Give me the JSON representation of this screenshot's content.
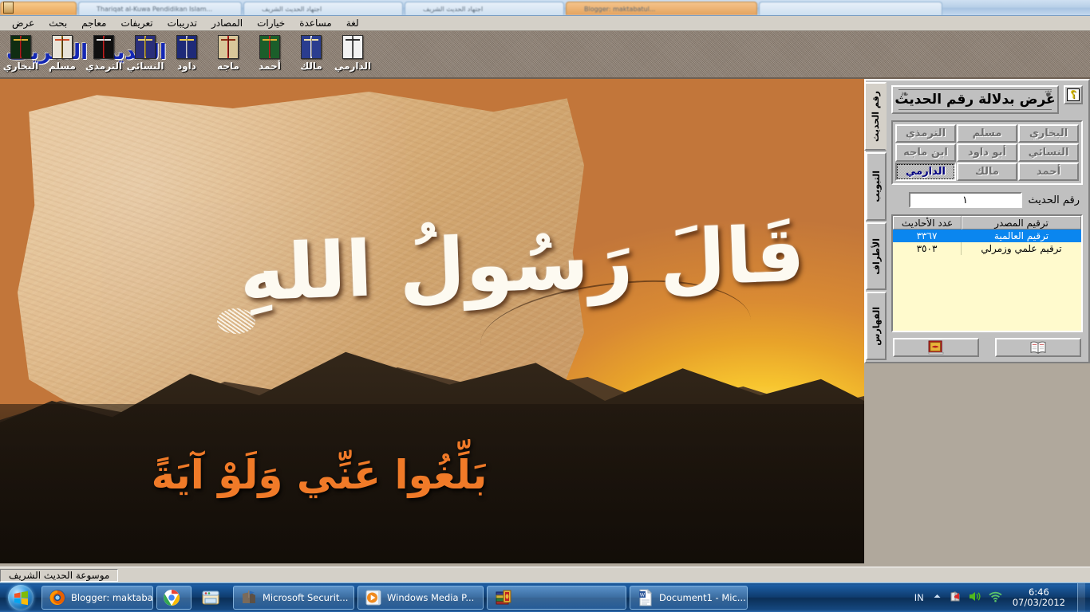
{
  "browser": {
    "tabs": [
      {
        "title": ""
      },
      {
        "title": "Thariqat al-Kuwa Pendidikan Islam..."
      },
      {
        "title": "اجتهاد الحديث الشريف"
      },
      {
        "title": "اجتهاد الحديث الشريف"
      },
      {
        "title": "Blogger: maktabatul..."
      },
      {
        "title": ""
      }
    ]
  },
  "app": {
    "title": "موسوعة الحديث الشريف",
    "logo": "الحديث الشريف",
    "statusbar": "موسوعة الحديث الشريف"
  },
  "menubar": {
    "items": [
      {
        "label": "عرض",
        "name": "menu-view"
      },
      {
        "label": "بحث",
        "name": "menu-search"
      },
      {
        "label": "معاجم",
        "name": "menu-dictionaries"
      },
      {
        "label": "تعريفات",
        "name": "menu-definitions"
      },
      {
        "label": "تدريبات",
        "name": "menu-exercises"
      },
      {
        "label": "المصادر",
        "name": "menu-sources"
      },
      {
        "label": "خيارات",
        "name": "menu-options"
      },
      {
        "label": "مساعدة",
        "name": "menu-help"
      },
      {
        "label": "لغة",
        "name": "menu-language"
      }
    ]
  },
  "toolbar": {
    "buttons": [
      {
        "label": "البخاري",
        "name": "toolbar-bukhari",
        "cover": "#0f2d12",
        "spine": "#b21d1d",
        "accent": "#e0b032"
      },
      {
        "label": "مسلم",
        "name": "toolbar-muslim",
        "cover": "#e8e4d8",
        "spine": "#8a6a1a",
        "accent": "#d04a24"
      },
      {
        "label": "الترمذي",
        "name": "toolbar-tirmidhi",
        "cover": "#101010",
        "spine": "#c01f1f",
        "accent": "#e6e6e6"
      },
      {
        "label": "النسائي",
        "name": "toolbar-nasai",
        "cover": "#2a2f7a",
        "spine": "#d4b43a",
        "accent": "#e8d06a"
      },
      {
        "label": "داود",
        "name": "toolbar-dawud",
        "cover": "#1e2a78",
        "spine": "#c9c9dd",
        "accent": "#f0d24a"
      },
      {
        "label": "ماجه",
        "name": "toolbar-majah",
        "cover": "#d9c79a",
        "spine": "#b81f1f",
        "accent": "#8a2b12"
      },
      {
        "label": "أحمد",
        "name": "toolbar-ahmad",
        "cover": "#1b5e2a",
        "spine": "#c32222",
        "accent": "#e0b032"
      },
      {
        "label": "مالك",
        "name": "toolbar-malik",
        "cover": "#2a3d8f",
        "spine": "#e8e8f0",
        "accent": "#f2e2a8"
      },
      {
        "label": "الدارمي",
        "name": "toolbar-darimi",
        "cover": "#f2f2f2",
        "spine": "#5a5a5a",
        "accent": "#303030"
      }
    ]
  },
  "wallpaper": {
    "calligraphy_main": "قَالَ رَسُولُ اللهِ",
    "calligraphy_sub": "بَلِّغُوا عَنِّي وَلَوْ آيَةً"
  },
  "panel": {
    "title": "عرض بدلالة رقم الحديث",
    "help_label": "؟",
    "vertical_tabs": [
      {
        "label": "رقم الحديث",
        "active": true,
        "name": "vtab-hadith-number"
      },
      {
        "label": "التبويب",
        "active": false,
        "name": "vtab-chapters"
      },
      {
        "label": "الأطراف",
        "active": false,
        "name": "vtab-atraf"
      },
      {
        "label": "الفهارس",
        "active": false,
        "name": "vtab-indexes"
      }
    ],
    "sources": [
      {
        "label": "البخاري",
        "selected": false,
        "name": "source-bukhari"
      },
      {
        "label": "مسلم",
        "selected": false,
        "name": "source-muslim"
      },
      {
        "label": "الترمذي",
        "selected": false,
        "name": "source-tirmidhi"
      },
      {
        "label": "النسائي",
        "selected": false,
        "name": "source-nasai"
      },
      {
        "label": "أبو داود",
        "selected": false,
        "name": "source-abu-dawud"
      },
      {
        "label": "ابن ماجه",
        "selected": false,
        "name": "source-ibn-majah"
      },
      {
        "label": "أحمد",
        "selected": false,
        "name": "source-ahmad"
      },
      {
        "label": "مالك",
        "selected": false,
        "name": "source-malik"
      },
      {
        "label": "الدارمي",
        "selected": true,
        "name": "source-darimi"
      }
    ],
    "number_field": {
      "label": "رقم الحديث",
      "value": "١",
      "placeholder": ""
    },
    "table": {
      "headers": {
        "source": "ترقيم المصدر",
        "count": "عدد الأحاديث"
      },
      "rows": [
        {
          "source": "ترقيم العالمية",
          "count": "٣٣٦٧",
          "selected": true
        },
        {
          "source": "ترقيم علمي وزمرلي",
          "count": "٣٥٠٣",
          "selected": false
        }
      ]
    },
    "actions": [
      {
        "name": "action-closed-book",
        "icon": "closed-book-icon"
      },
      {
        "name": "action-open-book",
        "icon": "open-book-icon"
      }
    ]
  },
  "taskbar": {
    "start": "start-orb",
    "tasks": [
      {
        "label": "Blogger: maktaba...",
        "icon": "firefox-icon",
        "name": "taskbar-firefox",
        "pinned": false
      },
      {
        "label": "",
        "icon": "chrome-icon",
        "name": "taskbar-chrome",
        "pinned": true
      },
      {
        "label": "",
        "icon": "explorer-icon",
        "name": "taskbar-explorer",
        "pinned": true
      },
      {
        "label": "Microsoft Securit...",
        "icon": "security-essentials-icon",
        "name": "taskbar-security-essentials",
        "pinned": false
      },
      {
        "label": "Windows Media P...",
        "icon": "media-player-icon",
        "name": "taskbar-media-player",
        "pinned": false
      },
      {
        "label": "",
        "icon": "hadith-books-icon",
        "name": "taskbar-hadith-app",
        "pinned": false
      },
      {
        "label": "Document1 - Mic...",
        "icon": "word-icon",
        "name": "taskbar-word",
        "pinned": false
      }
    ],
    "tray": {
      "language": "IN",
      "icons": [
        {
          "name": "show-hidden-icons-arrow"
        },
        {
          "name": "security-shield-icon"
        },
        {
          "name": "volume-icon"
        },
        {
          "name": "network-wifi-icon"
        }
      ],
      "time": "6:46",
      "date": "07/03/2012"
    }
  },
  "colors": {
    "accent_blue": "#0a86ef",
    "window_face": "#c0c0c0",
    "listbox_bg": "#fffacd",
    "logo_blue": "#1428b4",
    "sub_orange": "#f07a28"
  }
}
